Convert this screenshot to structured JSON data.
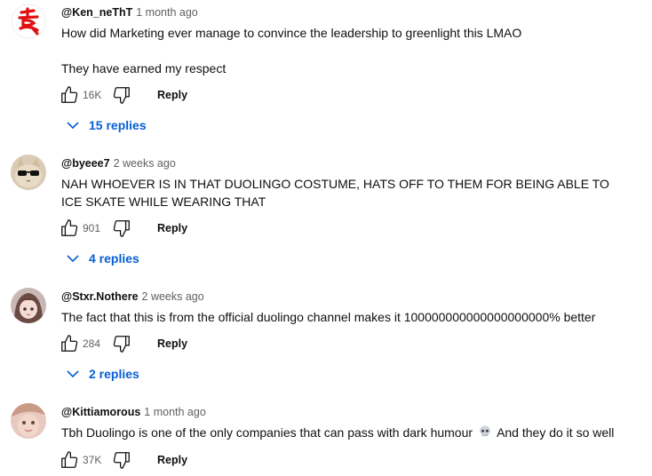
{
  "comments": [
    {
      "author": "@Ken_neThT",
      "time": "1 month ago",
      "text1": "How did Marketing ever manage to convince the leadership to greenlight this LMAO",
      "text2": "They have earned my respect",
      "likes": "16K",
      "reply_label": "Reply",
      "replies_label": "15 replies",
      "avatar_icon": "red-kanji-avatar-icon"
    },
    {
      "author": "@byeee7",
      "time": "2 weeks ago",
      "text1": "NAH WHOEVER IS IN THAT DUOLINGO COSTUME, HATS OFF TO THEM FOR BEING ABLE TO ICE SKATE WHILE WEARING THAT",
      "likes": "901",
      "reply_label": "Reply",
      "replies_label": "4 replies",
      "avatar_icon": "cat-sunglasses-avatar-icon"
    },
    {
      "author": "@Stxr.Nothere",
      "time": "2 weeks ago",
      "text1": "The fact that this is from the official duolingo channel makes it 100000000000000000000% better",
      "likes": "284",
      "reply_label": "Reply",
      "replies_label": "2 replies",
      "avatar_icon": "anime-girl-avatar-icon"
    },
    {
      "author": "@Kittiamorous",
      "time": "1 month ago",
      "text1": "Tbh Duolingo is one of the only companies that can pass with dark humour",
      "text1_after": "And they do it so well",
      "likes": "37K",
      "reply_label": "Reply",
      "avatar_icon": "selfie-avatar-icon"
    }
  ],
  "colors": {
    "link_blue": "#065fd4",
    "secondary_text": "#606060"
  }
}
